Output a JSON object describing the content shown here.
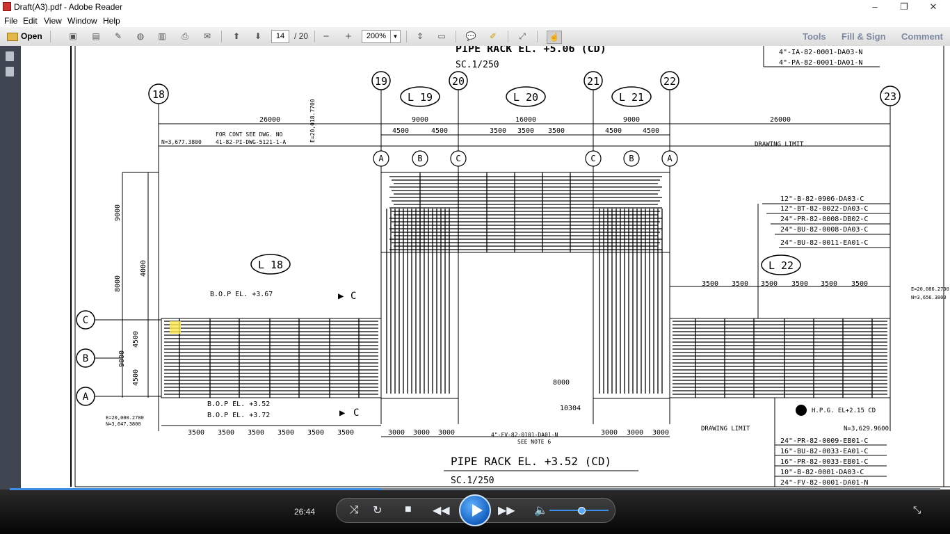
{
  "window": {
    "title": "Draft(A3).pdf - Adobe Reader",
    "minimize": "–",
    "restore": "❐",
    "close": "✕"
  },
  "menu": [
    "File",
    "Edit",
    "View",
    "Window",
    "Help"
  ],
  "toolbar": {
    "open_label": "Open",
    "page_current": "14",
    "page_total": "/ 20",
    "zoom": "200%",
    "tools": "Tools",
    "fill_sign": "Fill & Sign",
    "comment": "Comment"
  },
  "drawing": {
    "top_title": "PIPE RACK EL. +5.06 (CD)",
    "top_scale": "SC.1/250",
    "bottom_title": "PIPE RACK EL. +3.52 (CD)",
    "bottom_scale": "SC.1/250",
    "grid_numbers": [
      "18",
      "19",
      "20",
      "21",
      "22",
      "23"
    ],
    "grid_letters": [
      "C",
      "B",
      "A"
    ],
    "levels": [
      "L 19",
      "L 20",
      "L 21",
      "L 18",
      "L 22"
    ],
    "dims_top": [
      "26000",
      "9000",
      "16000",
      "9000",
      "26000"
    ],
    "dims_mid": [
      "4500",
      "4500",
      "3500",
      "3500",
      "3500",
      "4500",
      "4500"
    ],
    "dims_right": [
      "3500",
      "3500",
      "3500",
      "3500",
      "3500",
      "3500"
    ],
    "dims_bottom": [
      "3500",
      "3500",
      "3500",
      "3500",
      "3500",
      "3500",
      "3000",
      "3000",
      "3000",
      "3000",
      "3000",
      "3000"
    ],
    "dims_left_vertical": [
      "9000",
      "8000",
      "4000",
      "4500",
      "9000",
      "4500"
    ],
    "dim_8000": "8000",
    "dim_10304": "10304",
    "cont_note": "FOR CONT SEE DWG. NO",
    "cont_dwg": "41-82-PI-DWG-5121-1-A",
    "coord_top_left": "N=3,677.3800",
    "coord_top_e": "E=20,018.7700",
    "coord_bottom_e": "E=20,000.2700",
    "coord_bottom_n": "N=3,647.3800",
    "coord_right_e": "E=20,086.2700",
    "coord_right_n": "N=3,656.3800",
    "coord_right_n2": "N=3,629.9600",
    "drawing_limit": "DRAWING LIMIT",
    "bop_367": "B.O.P EL. +3.67",
    "bop_352": "B.O.P EL. +3.52",
    "bop_372": "B.O.P EL. +3.72",
    "section_c": "C",
    "hpg": "H.P.G. EL+2.15 CD",
    "fv_line": "4\"-FV-82-0101-DA01-N",
    "see_note": "SEE NOTE 6",
    "lines_top_right": [
      "4\"-IA-82-0001-DA03-N",
      "4\"-PA-82-0001-DA01-N"
    ],
    "lines_right_upper": [
      "12\"-B-82-0906-DA03-C",
      "12\"-BT-82-0022-DA03-C",
      "24\"-PR-82-0008-DB02-C",
      "24\"-BU-82-0008-DA03-C",
      "24\"-BU-82-0011-EA01-C"
    ],
    "lines_right_lower": [
      "24\"-PR-82-0009-EB01-C",
      "16\"-BU-82-0033-EA01-C",
      "16\"-PR-82-0033-EB01-C",
      "10\"-B-82-0001-DA03-C",
      "24\"-FV-82-0001-DA01-N"
    ]
  },
  "player": {
    "time": "26:44",
    "progress": 0.4
  }
}
